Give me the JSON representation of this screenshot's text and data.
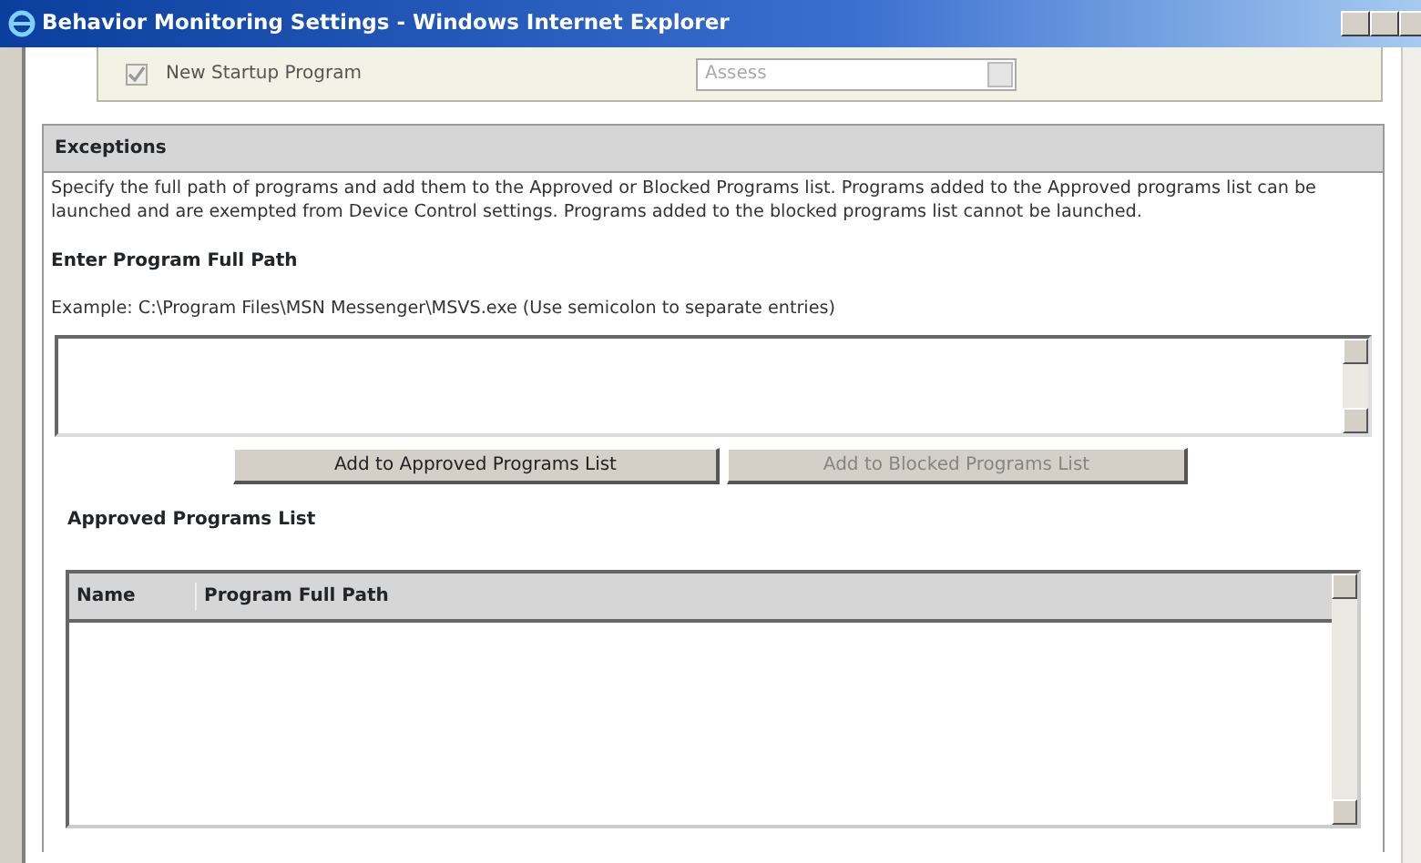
{
  "window": {
    "title": "Behavior Monitoring Settings - Windows Internet Explorer"
  },
  "startup_row": {
    "checked": true,
    "disabled": true,
    "label": "New Startup Program",
    "action": "Assess"
  },
  "exceptions": {
    "title": "Exceptions",
    "description": "Specify the full path of programs and add them to the Approved or Blocked Programs list. Programs added to the Approved programs list can be launched and are exempted from Device Control settings. Programs added to the blocked programs list cannot be launched.",
    "path_label": "Enter Program Full Path",
    "example": "Example: C:\\Program Files\\MSN Messenger\\MSVS.exe (Use semicolon to separate entries)",
    "buttons": [
      {
        "label": "Add to Approved Programs List",
        "disabled": false
      },
      {
        "label": "Add to Blocked Programs List",
        "disabled": true
      }
    ],
    "approved_list": {
      "title": "Approved Programs List",
      "columns": [
        "Name",
        "Program Full Path"
      ]
    }
  }
}
